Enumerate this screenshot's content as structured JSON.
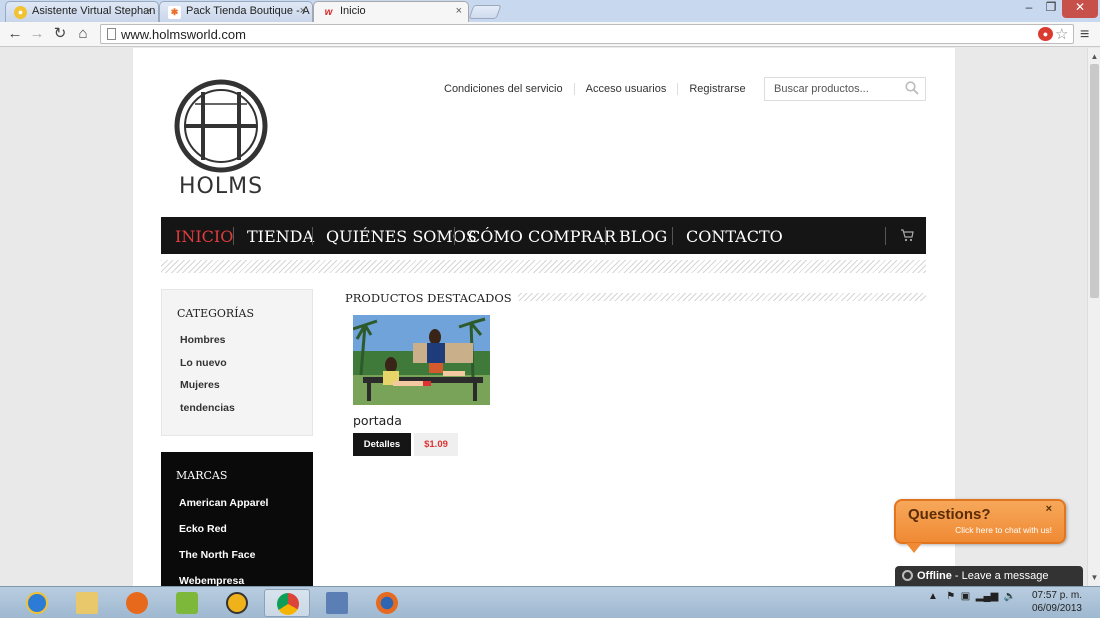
{
  "browser": {
    "tabs": [
      {
        "title": "Asistente Virtual Stephan",
        "favicon": "yellow-circle-icon",
        "close": "×"
      },
      {
        "title": "Pack Tienda Boutique - A",
        "favicon": "joomla-icon",
        "close": "×"
      },
      {
        "title": "Inicio",
        "favicon": "w-logo-icon",
        "close": "×",
        "active": true
      }
    ],
    "window_controls": [
      "–",
      "❐",
      "✕"
    ],
    "nav": {
      "back": "←",
      "forward": "→",
      "reload": "↻",
      "home": "⌂"
    },
    "url": "www.holmsworld.com",
    "menu_icon": "≡"
  },
  "site": {
    "logo_text": "HOLMS",
    "top_links": [
      "Condiciones del servicio",
      "Acceso usuarios",
      "Registrarse"
    ],
    "search_placeholder": "Buscar productos...",
    "nav_items": [
      "INICIO",
      "TIENDA",
      "QUIÉNES SOMOS",
      "CÓMO COMPRAR",
      "BLOG",
      "CONTACTO"
    ],
    "active_nav": "INICIO",
    "categories": {
      "title": "CATEGORÍAS",
      "items": [
        "Hombres",
        "Lo nuevo",
        "Mujeres",
        "tendencias"
      ]
    },
    "brands": {
      "title": "MARCAS",
      "items": [
        "American Apparel",
        "Ecko Red",
        "The North Face",
        "Webempresa"
      ]
    },
    "featured": {
      "title": "PRODUCTOS DESTACADOS",
      "products": [
        {
          "name": "portada",
          "details_label": "Detalles",
          "price": "$1.09"
        }
      ]
    }
  },
  "chat": {
    "title": "Questions?",
    "subtitle": "Click here to chat with us!",
    "close": "×",
    "offline_label": "Offline",
    "offline_text": " - Leave a message"
  },
  "taskbar": {
    "apps": [
      "internet-explorer-icon",
      "file-explorer-icon",
      "orange-app-icon",
      "w-app-icon",
      "speedometer-app-icon",
      "chrome-icon",
      "network-app-icon",
      "firefox-icon"
    ],
    "clock_time": "07:57 p. m.",
    "clock_date": "06/09/2013"
  },
  "colors": {
    "accent": "#e23c3c",
    "nav_bg": "#151515",
    "chat_orange": "#f08a34"
  }
}
